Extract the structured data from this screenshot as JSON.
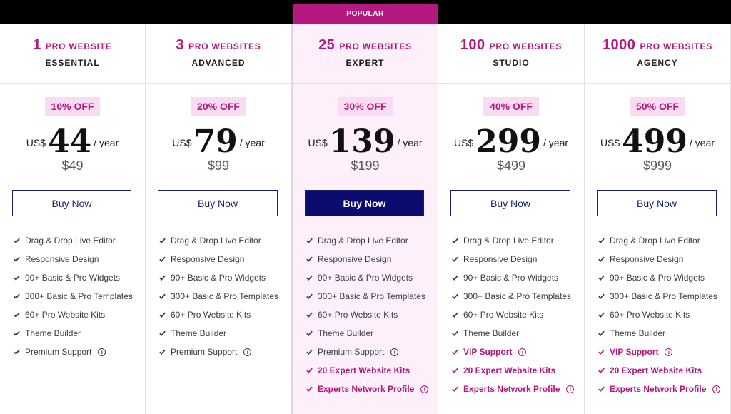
{
  "popular_label": "POPULAR",
  "plans": [
    {
      "count": "1",
      "sites_text": "PRO WEBSITE",
      "tier": "ESSENTIAL",
      "discount": "10% OFF",
      "currency": "US$",
      "price": "44",
      "period": "/ year",
      "old_price": "$49",
      "button": "Buy Now",
      "features": [
        {
          "label": "Drag & Drop Live Editor"
        },
        {
          "label": "Responsive Design"
        },
        {
          "label": "90+ Basic & Pro Widgets"
        },
        {
          "label": "300+ Basic & Pro Templates"
        },
        {
          "label": "60+ Pro Website Kits"
        },
        {
          "label": "Theme Builder"
        },
        {
          "label": "Premium Support",
          "info": true
        }
      ]
    },
    {
      "count": "3",
      "sites_text": "PRO WEBSITES",
      "tier": "ADVANCED",
      "discount": "20% OFF",
      "currency": "US$",
      "price": "79",
      "period": "/ year",
      "old_price": "$99",
      "button": "Buy Now",
      "features": [
        {
          "label": "Drag & Drop Live Editor"
        },
        {
          "label": "Responsive Design"
        },
        {
          "label": "90+ Basic & Pro Widgets"
        },
        {
          "label": "300+ Basic & Pro Templates"
        },
        {
          "label": "60+ Pro Website Kits"
        },
        {
          "label": "Theme Builder"
        },
        {
          "label": "Premium Support",
          "info": true
        }
      ]
    },
    {
      "count": "25",
      "sites_text": "PRO WEBSITES",
      "tier": "EXPERT",
      "popular": true,
      "discount": "30% OFF",
      "currency": "US$",
      "price": "139",
      "period": "/ year",
      "old_price": "$199",
      "button": "Buy Now",
      "features": [
        {
          "label": "Drag & Drop Live Editor"
        },
        {
          "label": "Responsive Design"
        },
        {
          "label": "90+ Basic & Pro Widgets"
        },
        {
          "label": "300+ Basic & Pro Templates"
        },
        {
          "label": "60+ Pro Website Kits"
        },
        {
          "label": "Theme Builder"
        },
        {
          "label": "Premium Support",
          "info": true
        },
        {
          "label": "20 Expert Website Kits",
          "highlight": true
        },
        {
          "label": "Experts Network Profile",
          "highlight": true,
          "info": true
        }
      ]
    },
    {
      "count": "100",
      "sites_text": "PRO WEBSITES",
      "tier": "STUDIO",
      "discount": "40% OFF",
      "currency": "US$",
      "price": "299",
      "period": "/ year",
      "old_price": "$499",
      "button": "Buy Now",
      "features": [
        {
          "label": "Drag & Drop Live Editor"
        },
        {
          "label": "Responsive Design"
        },
        {
          "label": "90+ Basic & Pro Widgets"
        },
        {
          "label": "300+ Basic & Pro Templates"
        },
        {
          "label": "60+ Pro Website Kits"
        },
        {
          "label": "Theme Builder"
        },
        {
          "label": "VIP Support",
          "highlight": true,
          "info": true
        },
        {
          "label": "20 Expert Website Kits",
          "highlight": true
        },
        {
          "label": "Experts Network Profile",
          "highlight": true,
          "info": true
        }
      ]
    },
    {
      "count": "1000",
      "sites_text": "PRO WEBSITES",
      "tier": "AGENCY",
      "discount": "50% OFF",
      "currency": "US$",
      "price": "499",
      "period": "/ year",
      "old_price": "$999",
      "button": "Buy Now",
      "features": [
        {
          "label": "Drag & Drop Live Editor"
        },
        {
          "label": "Responsive Design"
        },
        {
          "label": "90+ Basic & Pro Widgets"
        },
        {
          "label": "300+ Basic & Pro Templates"
        },
        {
          "label": "60+ Pro Website Kits"
        },
        {
          "label": "Theme Builder"
        },
        {
          "label": "VIP Support",
          "highlight": true,
          "info": true
        },
        {
          "label": "20 Expert Website Kits",
          "highlight": true
        },
        {
          "label": "Experts Network Profile",
          "highlight": true,
          "info": true
        }
      ]
    }
  ],
  "colors": {
    "accent": "#b5187f",
    "button_navy": "#0c0b70",
    "popular_bg": "#fdf0fb",
    "discount_bg": "#f9dcf1"
  },
  "icons": {
    "check": "check-icon",
    "info": "info-icon"
  }
}
